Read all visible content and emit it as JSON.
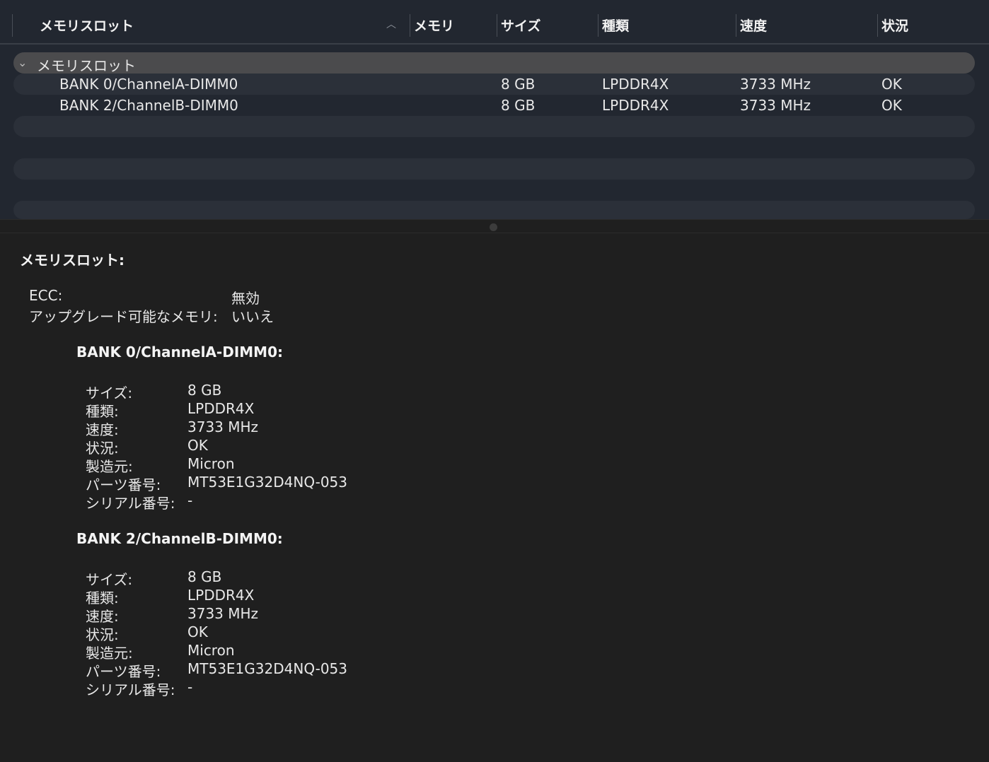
{
  "table": {
    "columns": [
      "メモリスロット",
      "メモリ",
      "サイズ",
      "種類",
      "速度",
      "状況"
    ],
    "group": "メモリスロット",
    "rows": [
      {
        "name": "BANK 0/ChannelA-DIMM0",
        "size": "8 GB",
        "type": "LPDDR4X",
        "speed": "3733 MHz",
        "status": "OK"
      },
      {
        "name": "BANK 2/ChannelB-DIMM0",
        "size": "8 GB",
        "type": "LPDDR4X",
        "speed": "3733 MHz",
        "status": "OK"
      }
    ]
  },
  "detail": {
    "title": "メモリスロット:",
    "ecc_label": "ECC:",
    "ecc_value": "無効",
    "upgrade_label": "アップグレード可能なメモリ:",
    "upgrade_value": "いいえ",
    "labels": {
      "size": "サイズ:",
      "type": "種類:",
      "speed": "速度:",
      "status": "状況:",
      "maker": "製造元:",
      "part": "パーツ番号:",
      "serial": "シリアル番号:"
    },
    "banks": [
      {
        "title": "BANK 0/ChannelA-DIMM0:",
        "size": "8 GB",
        "type": "LPDDR4X",
        "speed": "3733 MHz",
        "status": "OK",
        "maker": "Micron",
        "part": "MT53E1G32D4NQ-053",
        "serial": "-"
      },
      {
        "title": "BANK 2/ChannelB-DIMM0:",
        "size": "8 GB",
        "type": "LPDDR4X",
        "speed": "3733 MHz",
        "status": "OK",
        "maker": "Micron",
        "part": "MT53E1G32D4NQ-053",
        "serial": "-"
      }
    ]
  }
}
